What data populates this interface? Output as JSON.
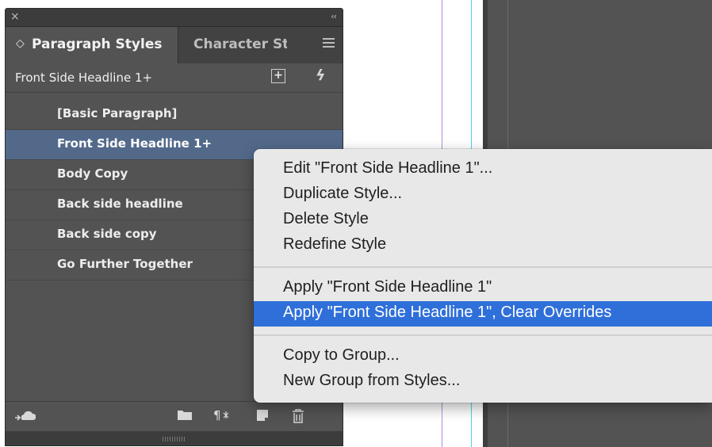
{
  "panel": {
    "close_glyph": "×",
    "collapse_glyph": "‹‹",
    "tabs": [
      {
        "label": "Paragraph Styles",
        "active": true
      },
      {
        "label": "Character St",
        "active": false
      }
    ],
    "current_style": "Front Side Headline 1+",
    "styles": [
      {
        "label": "[Basic Paragraph]",
        "selected": false
      },
      {
        "label": "Front Side Headline 1+",
        "selected": true
      },
      {
        "label": "Body Copy",
        "selected": false
      },
      {
        "label": "Back side headline",
        "selected": false
      },
      {
        "label": "Back side copy",
        "selected": false
      },
      {
        "label": "Go Further Together",
        "selected": false
      }
    ],
    "footer_icons": [
      "cloud-library-icon",
      "new-group-folder-icon",
      "clear-overrides-icon",
      "new-style-icon",
      "delete-trash-icon"
    ]
  },
  "context_menu": {
    "items": [
      {
        "label": "Edit \"Front Side Headline 1\"...",
        "highlighted": false
      },
      {
        "label": "Duplicate Style...",
        "highlighted": false
      },
      {
        "label": "Delete Style",
        "highlighted": false
      },
      {
        "label": "Redefine Style",
        "highlighted": false
      },
      {
        "label": "Apply \"Front Side Headline 1\"",
        "highlighted": false
      },
      {
        "label": "Apply \"Front Side Headline 1\", Clear Overrides",
        "highlighted": true
      },
      {
        "label": "Copy to Group...",
        "highlighted": false
      },
      {
        "label": "New Group from Styles...",
        "highlighted": false
      }
    ]
  },
  "colors": {
    "panel_bg": "#535353",
    "selection": "#52698a",
    "menu_highlight": "#2f6fd9",
    "guide_purple": "#b58ad6",
    "guide_cyan": "#4fd2e6"
  }
}
